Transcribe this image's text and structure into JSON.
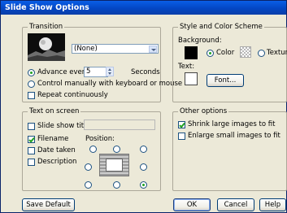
{
  "window": {
    "title": "Slide Show Options"
  },
  "transition": {
    "group_label": "Transition",
    "effect_value": "(None)",
    "advance_label": "Advance every:",
    "advance_value": "5",
    "advance_unit": "Seconds",
    "manual_label": "Control manually with keyboard or mouse",
    "repeat_label": "Repeat continuously",
    "advance_selected": true,
    "manual_selected": false,
    "repeat_checked": false
  },
  "style": {
    "group_label": "Style and Color Scheme",
    "background_label": "Background:",
    "color_label": "Color",
    "texture_label": "Texture",
    "background_mode": "color",
    "background_color": "#000000",
    "text_label": "Text:",
    "text_color": "#ffffff",
    "font_button": "Font..."
  },
  "text_on_screen": {
    "group_label": "Text on screen",
    "slide_title_label": "Slide show title:",
    "slide_title_value": "",
    "filename_label": "Filename",
    "date_label": "Date taken",
    "description_label": "Description",
    "position_label": "Position:",
    "slide_title_checked": false,
    "filename_checked": true,
    "date_checked": false,
    "description_checked": false,
    "position_selected": "bottom-right"
  },
  "other": {
    "group_label": "Other options",
    "shrink_label": "Shrink large images to fit",
    "enlarge_label": "Enlarge small images to fit",
    "shrink_checked": true,
    "enlarge_checked": false
  },
  "buttons": {
    "save_default": "Save Default",
    "ok": "OK",
    "cancel": "Cancel",
    "help": "Help"
  }
}
